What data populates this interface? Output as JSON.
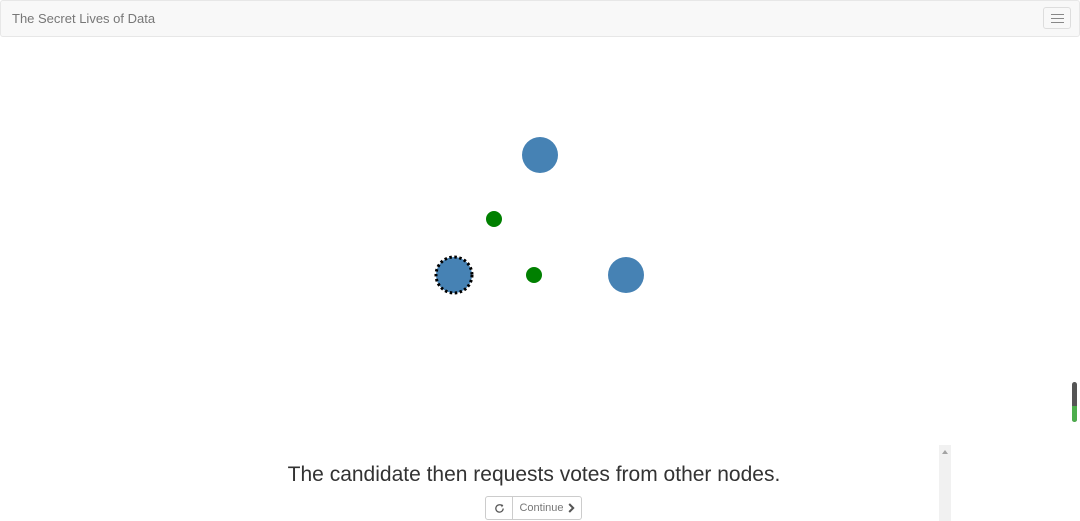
{
  "navbar": {
    "brand": "The Secret Lives of Data",
    "menu_icon": "hamburger-menu-icon"
  },
  "diagram": {
    "nodes": [
      {
        "name": "node-top",
        "role": "follower",
        "color": "#4682b4"
      },
      {
        "name": "node-left",
        "role": "candidate",
        "color": "#4682b4",
        "border": "dashed-black"
      },
      {
        "name": "node-right",
        "role": "follower",
        "color": "#4682b4"
      }
    ],
    "messages": [
      {
        "name": "vote-request-to-top",
        "color": "#008000"
      },
      {
        "name": "vote-request-to-right",
        "color": "#008000"
      }
    ]
  },
  "caption": {
    "text": "The candidate then requests votes from other nodes."
  },
  "controls": {
    "reload_icon": "reload-icon",
    "continue_label": "Continue",
    "continue_icon": "chevron-right-icon"
  },
  "colors": {
    "node": "#4682b4",
    "message": "#008000",
    "progress_fill": "#4cae4c"
  }
}
